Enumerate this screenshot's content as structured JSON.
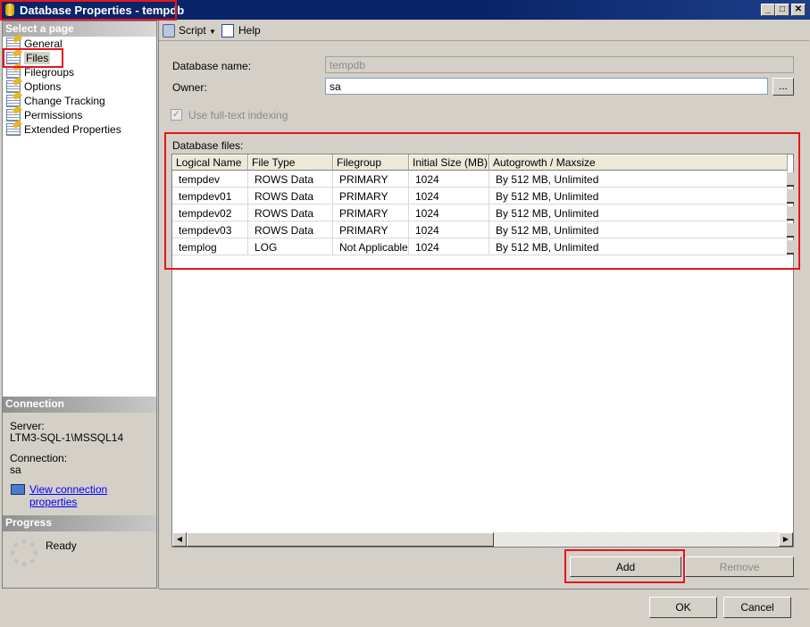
{
  "window": {
    "title": "Database Properties - tempdb",
    "min": "_",
    "max": "□",
    "close": "✕"
  },
  "left": {
    "select_header": "Select a page",
    "pages": [
      {
        "label": "General"
      },
      {
        "label": "Files"
      },
      {
        "label": "Filegroups"
      },
      {
        "label": "Options"
      },
      {
        "label": "Change Tracking"
      },
      {
        "label": "Permissions"
      },
      {
        "label": "Extended Properties"
      }
    ],
    "connection_header": "Connection",
    "server_label": "Server:",
    "server_value": "LTM3-SQL-1\\MSSQL14",
    "connection_label": "Connection:",
    "connection_value": "sa",
    "view_link": "View connection properties",
    "progress_header": "Progress",
    "progress_status": "Ready"
  },
  "toolbar": {
    "script": "Script",
    "help": "Help"
  },
  "form": {
    "db_name_label": "Database name:",
    "db_name_value": "tempdb",
    "owner_label": "Owner:",
    "owner_value": "sa",
    "browse": "...",
    "fulltext_label": "Use full-text indexing",
    "files_label": "Database files:"
  },
  "grid": {
    "columns": [
      "Logical Name",
      "File Type",
      "Filegroup",
      "Initial Size (MB)",
      "Autogrowth / Maxsize"
    ],
    "rows": [
      [
        "tempdev",
        "ROWS Data",
        "PRIMARY",
        "1024",
        "By 512 MB, Unlimited"
      ],
      [
        "tempdev01",
        "ROWS Data",
        "PRIMARY",
        "1024",
        "By 512 MB, Unlimited"
      ],
      [
        "tempdev02",
        "ROWS Data",
        "PRIMARY",
        "1024",
        "By 512 MB, Unlimited"
      ],
      [
        "tempdev03",
        "ROWS Data",
        "PRIMARY",
        "1024",
        "By 512 MB, Unlimited"
      ],
      [
        "templog",
        "LOG",
        "Not Applicable",
        "1024",
        "By 512 MB, Unlimited"
      ]
    ]
  },
  "buttons": {
    "add": "Add",
    "remove": "Remove",
    "ok": "OK",
    "cancel": "Cancel"
  },
  "colors": {
    "titlebar": "#0a246a",
    "highlight": "#e8141c",
    "link": "#0000ff"
  }
}
